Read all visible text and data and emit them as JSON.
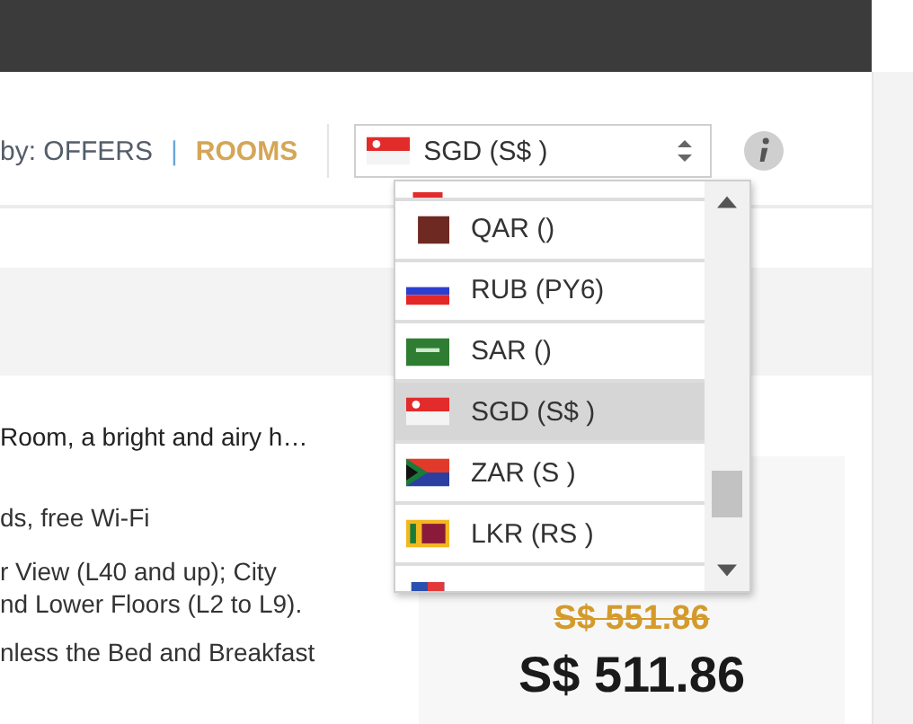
{
  "sort": {
    "label": "by: OFFERS",
    "separator": "|",
    "link": "ROOMS"
  },
  "currency_select": {
    "value": "SGD (S$ )",
    "options": [
      {
        "label": "QAR ()",
        "selected": false
      },
      {
        "label": "RUB (PY6)",
        "selected": false
      },
      {
        "label": "SAR ()",
        "selected": false
      },
      {
        "label": "SGD (S$ )",
        "selected": true
      },
      {
        "label": "ZAR (S )",
        "selected": false
      },
      {
        "label": "LKR (RS )",
        "selected": false
      }
    ]
  },
  "room": {
    "title": "Room, a bright and airy h…",
    "lines": [
      "ds, free Wi-Fi",
      "r View (L40 and up); City",
      "nd Lower Floors (L2 to L9).",
      "nless the Bed and Breakfast"
    ]
  },
  "price": {
    "original": "S$ 551.86",
    "current": "S$ 511.86"
  }
}
